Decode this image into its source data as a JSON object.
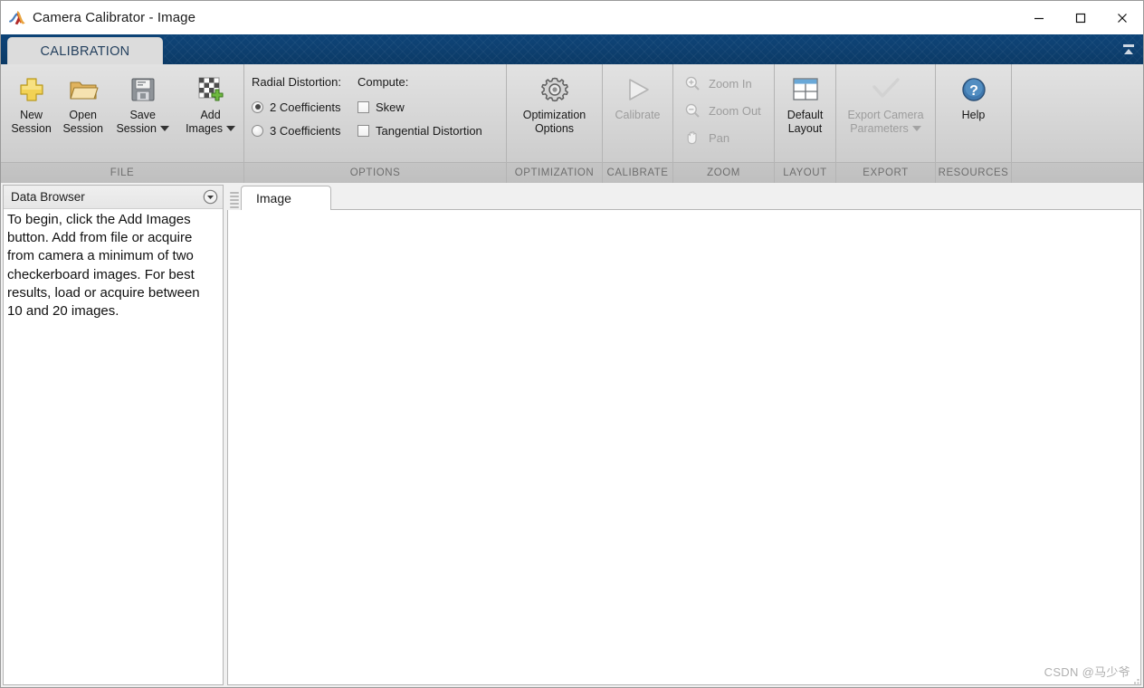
{
  "window": {
    "title": "Camera Calibrator - Image",
    "logo_icon": "matlab-membrane-logo",
    "minimize_label": "—",
    "maximize_label": "□",
    "close_label": "✕"
  },
  "ribbon": {
    "tab_label": "CALIBRATION",
    "collapse_icon": "collapse-ribbon-icon",
    "sections": [
      {
        "id": "file",
        "label": "FILE",
        "buttons": [
          {
            "label_line1": "New",
            "label_line2": "Session",
            "icon": "yellow-plus-icon",
            "enabled": true,
            "has_caret": false
          },
          {
            "label_line1": "Open",
            "label_line2": "Session",
            "icon": "open-folder-icon",
            "enabled": true,
            "has_caret": false
          },
          {
            "label_line1": "Save",
            "label_line2": "Session",
            "icon": "floppy-disk-save-icon",
            "enabled": true,
            "has_caret": true
          },
          {
            "label_line1": "Add",
            "label_line2": "Images",
            "icon": "checkerboard-add-icon",
            "enabled": true,
            "has_caret": true
          }
        ]
      },
      {
        "id": "options",
        "label": "OPTIONS",
        "groups": [
          {
            "heading": "Radial Distortion:",
            "control_type": "radio",
            "items": [
              {
                "label": "2 Coefficients",
                "selected": true
              },
              {
                "label": "3 Coefficients",
                "selected": false
              }
            ]
          },
          {
            "heading": "Compute:",
            "control_type": "checkbox",
            "items": [
              {
                "label": "Skew",
                "selected": false
              },
              {
                "label": "Tangential Distortion",
                "selected": false
              }
            ]
          }
        ]
      },
      {
        "id": "optimization",
        "label": "OPTIMIZATION",
        "buttons": [
          {
            "label_line1": "Optimization",
            "label_line2": "Options",
            "icon": "gear-icon",
            "enabled": true,
            "has_caret": false
          }
        ]
      },
      {
        "id": "calibrate",
        "label": "CALIBRATE",
        "buttons": [
          {
            "label_line1": "Calibrate",
            "label_line2": "",
            "icon": "play-triangle-icon",
            "enabled": false,
            "has_caret": false
          }
        ]
      },
      {
        "id": "zoom",
        "label": "ZOOM",
        "small_buttons": [
          {
            "label": "Zoom In",
            "icon": "zoom-in-icon",
            "enabled": false
          },
          {
            "label": "Zoom Out",
            "icon": "zoom-out-icon",
            "enabled": false
          },
          {
            "label": "Pan",
            "icon": "hand-pan-icon",
            "enabled": false
          }
        ]
      },
      {
        "id": "layout",
        "label": "LAYOUT",
        "buttons": [
          {
            "label_line1": "Default",
            "label_line2": "Layout",
            "icon": "grid-layout-icon",
            "enabled": true,
            "has_caret": false
          }
        ]
      },
      {
        "id": "export",
        "label": "EXPORT",
        "buttons": [
          {
            "label_line1": "Export Camera",
            "label_line2": "Parameters",
            "icon": "checkmark-icon",
            "enabled": false,
            "has_caret": true
          }
        ]
      },
      {
        "id": "resources",
        "label": "RESOURCES",
        "buttons": [
          {
            "label_line1": "Help",
            "label_line2": "",
            "icon": "question-circle-icon",
            "enabled": true,
            "has_caret": false
          }
        ]
      }
    ]
  },
  "data_browser": {
    "title": "Data Browser",
    "collapse_icon": "chevron-down-circle-icon",
    "message": "To begin, click the Add Images button. Add from file or acquire from camera a minimum of two checkerboard images. For best results, load or acquire between 10 and 20 images."
  },
  "document_panel": {
    "grip_icon": "drag-grip-icon",
    "tabs": [
      {
        "label": "Image",
        "active": true
      }
    ]
  },
  "watermark": {
    "text": "CSDN @马少爷"
  }
}
